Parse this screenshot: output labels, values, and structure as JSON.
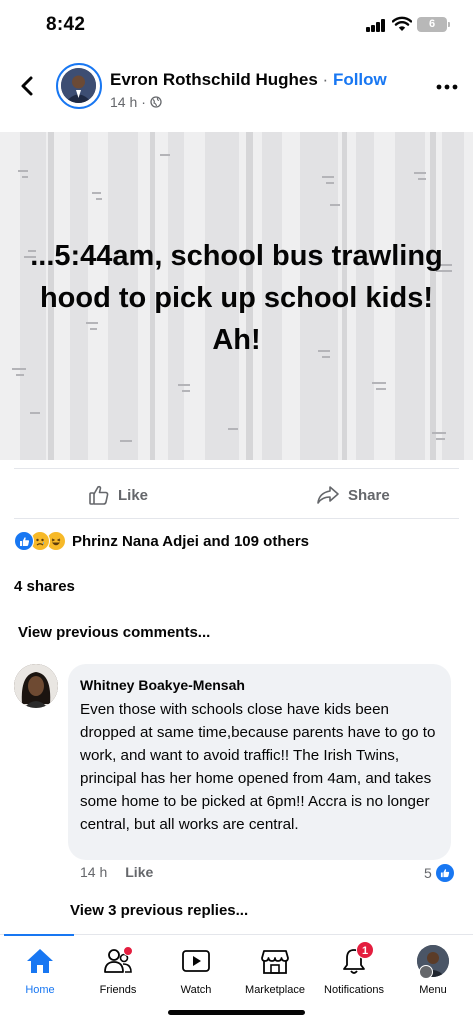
{
  "status_bar": {
    "time": "8:42",
    "battery_level": "6"
  },
  "header": {
    "author_name": "Evron Rothschild Hughes",
    "separator": "·",
    "follow_label": "Follow",
    "timestamp": "14 h",
    "meta_separator": "·",
    "privacy_icon": "globe-icon"
  },
  "post": {
    "text": "...5:44am, school bus trawling hood to pick up school kids! Ah!",
    "background_color": "#efeff0"
  },
  "actions": {
    "like_label": "Like",
    "share_label": "Share"
  },
  "reactions": {
    "icons": [
      "like-reaction-icon",
      "sad-reaction-icon",
      "haha-reaction-icon"
    ],
    "label": "Phrinz Nana Adjei and 109 others"
  },
  "shares_label": "4 shares",
  "view_previous_comments": "View previous comments...",
  "comment": {
    "author": "Whitney Boakye-Mensah",
    "text": "Even those with schools close have kids been dropped at same time,because parents have to go to work, and want to avoid traffic!! The Irish Twins, principal has her home opened from 4am, and takes some home to be picked at 6pm!! Accra is no longer central, but all works are central.",
    "timestamp": "14 h",
    "like_label": "Like",
    "reaction_count": "5"
  },
  "view_replies_label": "View 3 previous replies...",
  "bottom_nav": {
    "items": [
      {
        "label": "Home",
        "icon": "home-icon",
        "active": true
      },
      {
        "label": "Friends",
        "icon": "friends-icon"
      },
      {
        "label": "Watch",
        "icon": "watch-icon"
      },
      {
        "label": "Marketplace",
        "icon": "marketplace-icon"
      },
      {
        "label": "Notifications",
        "icon": "bell-icon",
        "badge": "1"
      },
      {
        "label": "Menu",
        "icon": "profile-avatar"
      }
    ]
  },
  "colors": {
    "accent": "#1877f2",
    "badge_red": "#e41e3f",
    "secondary_text": "#65676b",
    "comment_bubble": "#f0f2f5"
  }
}
